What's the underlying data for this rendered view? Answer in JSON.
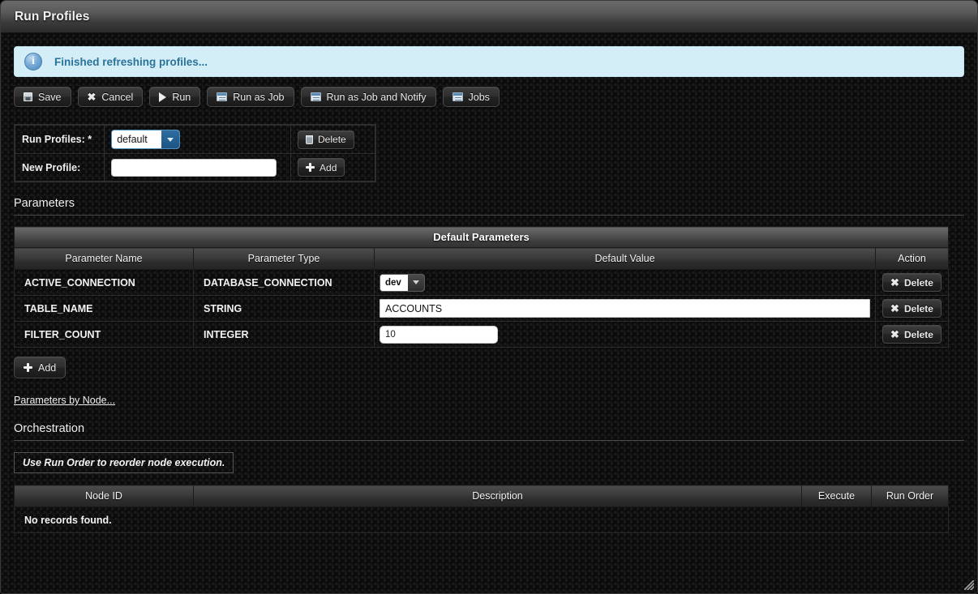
{
  "window": {
    "title": "Run Profiles"
  },
  "info": {
    "icon": "info-icon",
    "message": "Finished refreshing profiles..."
  },
  "toolbar": {
    "save": "Save",
    "cancel": "Cancel",
    "run": "Run",
    "run_as_job": "Run as Job",
    "run_as_job_and_notify": "Run as Job and Notify",
    "jobs": "Jobs"
  },
  "profile": {
    "run_profiles_label": "Run Profiles: *",
    "run_profiles_value": "default",
    "delete_label": "Delete",
    "new_profile_label": "New Profile:",
    "new_profile_value": "",
    "new_profile_placeholder": "",
    "add_label": "Add"
  },
  "parameters": {
    "heading": "Parameters",
    "caption": "Default Parameters",
    "columns": [
      "Parameter Name",
      "Parameter Type",
      "Default Value",
      "Action"
    ],
    "rows": [
      {
        "name": "ACTIVE_CONNECTION",
        "type": "DATABASE_CONNECTION",
        "value": "dev",
        "control": "select",
        "action": "Delete"
      },
      {
        "name": "TABLE_NAME",
        "type": "STRING",
        "value": "ACCOUNTS",
        "control": "text",
        "action": "Delete"
      },
      {
        "name": "FILTER_COUNT",
        "type": "INTEGER",
        "value": "10",
        "control": "number",
        "action": "Delete"
      }
    ],
    "add_label": "Add",
    "by_node_link": "Parameters by Node..."
  },
  "orchestration": {
    "heading": "Orchestration",
    "hint": "Use Run Order to reorder node execution.",
    "columns": [
      "Node ID",
      "Description",
      "Execute",
      "Run Order"
    ],
    "empty_text": "No records found."
  },
  "colors": {
    "info_bg": "#d4eef8",
    "info_text": "#2b7399",
    "accent_select": "#2e6da0",
    "page_bg": "#0c0c0c"
  }
}
